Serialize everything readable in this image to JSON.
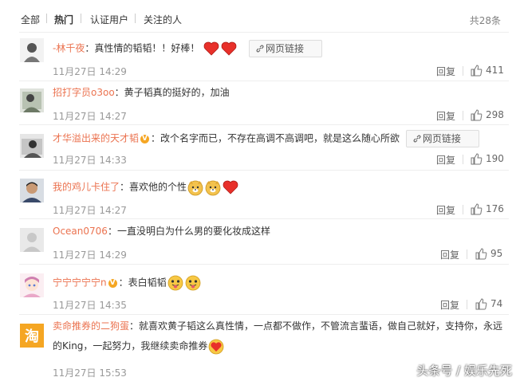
{
  "filter": {
    "tabs": [
      "全部",
      "热门",
      "认证用户",
      "关注的人"
    ],
    "active": "热门",
    "total": "共28条"
  },
  "comments": [
    {
      "user": "-林千夜",
      "text": "：真性情的韬韬！！好棒！",
      "emojis": [
        "heart",
        "heart"
      ],
      "link": "网页链接",
      "time": "11月27日 14:29",
      "reply": "回复",
      "likes": "411"
    },
    {
      "user": "招打字员o3oo",
      "text": "：黄子韬真的挺好的，加油",
      "time": "11月27日 14:27",
      "reply": "回复",
      "likes": "298"
    },
    {
      "user": "才华溢出来的天才韬",
      "verified": true,
      "text": "：改个名字而已，不存在高调不高调吧，就是这么随心所欲",
      "link": "网页链接",
      "time": "11月27日 14:33",
      "reply": "回复",
      "likes": "190"
    },
    {
      "user": "我的鸡儿卡住了",
      "text": "：喜欢他的个性",
      "emojis": [
        "doge",
        "doge",
        "heart"
      ],
      "time": "11月27日 14:27",
      "reply": "回复",
      "likes": "176"
    },
    {
      "user": "Ocean0706",
      "text": "：一直没明白为什么男的要化妆成这样",
      "time": "11月27日 14:29",
      "reply": "回复",
      "likes": "95"
    },
    {
      "user": "宁宁宁宁宁n",
      "verified": true,
      "text": "：表白韬韬",
      "emojis": [
        "tongue",
        "tongue"
      ],
      "time": "11月27日 14:35",
      "reply": "回复",
      "likes": "74"
    },
    {
      "user": "卖命推券的二狗蛋",
      "text": "：就喜欢黄子韬这么真性情，一点都不做作，不管流言蜚语，做自己就好，支持你，永远的King，一起努力，我继续卖命推券",
      "emojis": [
        "heart"
      ],
      "time": "11月27日 15:53"
    }
  ],
  "watermark": "头条号 / 娱乐先死"
}
